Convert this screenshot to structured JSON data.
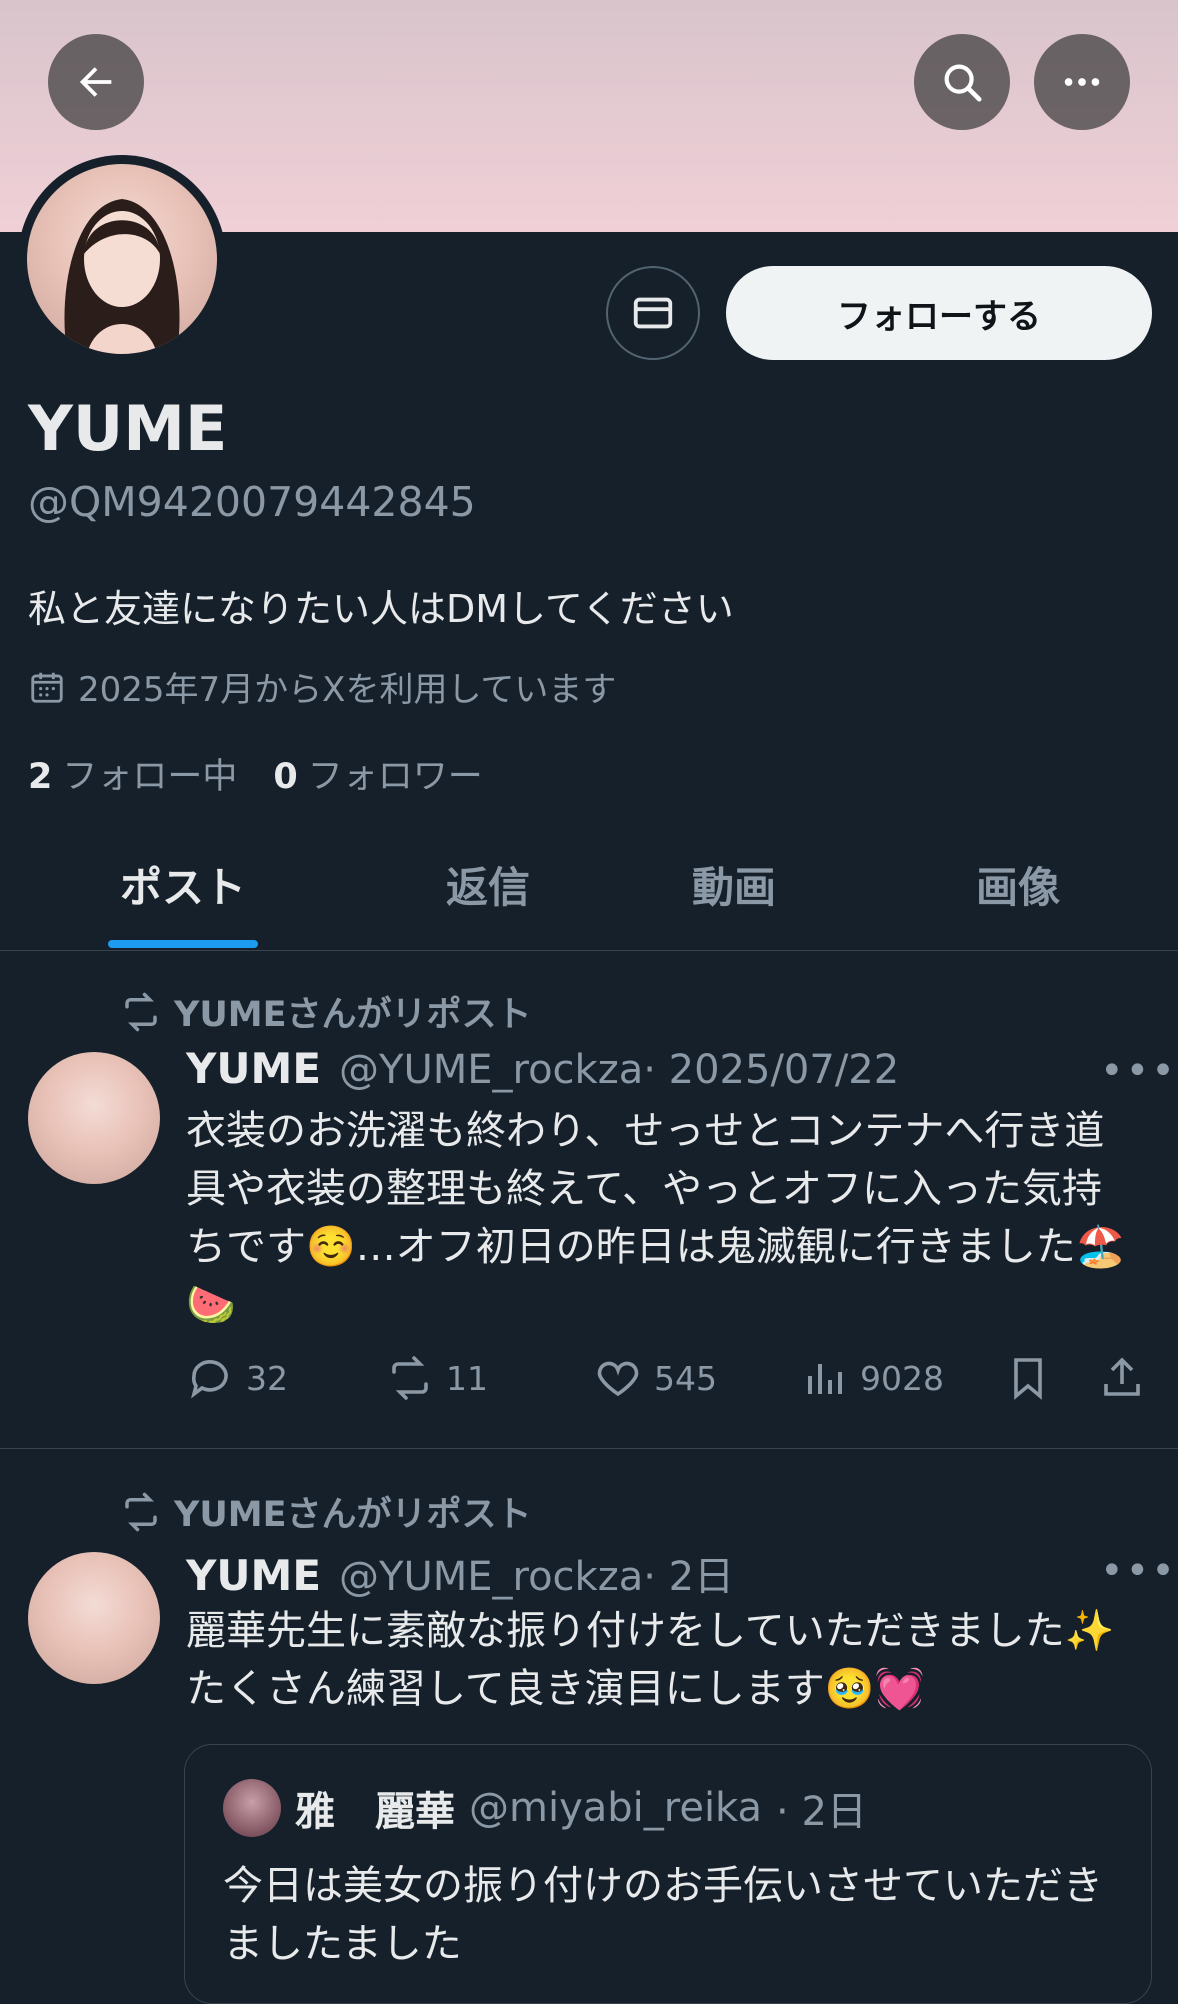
{
  "profile": {
    "name": "YUME",
    "handle": "@QM9420079442845",
    "bio": "私と友達になりたい人はDMしてください",
    "joined": "2025年7月からXを利用しています",
    "following_count": "2",
    "following_label": "フォロー中",
    "followers_count": "0",
    "followers_label": "フォロワー",
    "follow_button": "フォローする"
  },
  "tabs": [
    {
      "label": "ポスト"
    },
    {
      "label": "返信"
    },
    {
      "label": "動画"
    },
    {
      "label": "画像"
    }
  ],
  "active_tab": "ポスト",
  "posts": [
    {
      "repost_label": "YUMEさんがリポスト",
      "author": "YUME",
      "handle": "@YUME_rockza",
      "date": "· 2025/07/22",
      "text": "衣装のお洗濯も終わり、せっせとコンテナへ行き道具や衣装の整理も終えて、やっとオフに入った気持ちです☺️…オフ初日の昨日は鬼滅観に行きました🏖️🍉",
      "replies": "32",
      "reposts": "11",
      "likes": "545",
      "views": "9028"
    },
    {
      "repost_label": "YUMEさんがリポスト",
      "author": "YUME",
      "handle": "@YUME_rockza",
      "date": "· 2日",
      "text": "麗華先生に素敵な振り付けをしていただきました✨たくさん練習して良き演目にします🥹💓",
      "quote": {
        "author": "雅　麗華",
        "handle": "@miyabi_reika",
        "date": "· 2日",
        "text": "今日は美女の振り付けのお手伝いさせていただきましたました"
      }
    }
  ],
  "colors": {
    "background": "#15202b",
    "accent": "#1d9bf0",
    "secondary_text": "#8b98a5",
    "banner": "#f0d0d6"
  }
}
